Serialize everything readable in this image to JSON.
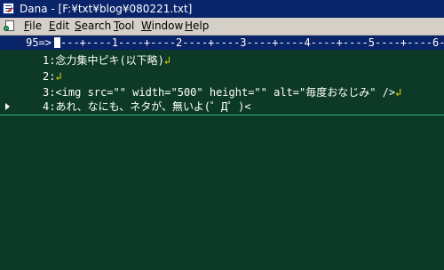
{
  "window": {
    "title": "Dana - [F:¥txt¥blog¥080221.txt]",
    "app_icon": "notepad-pen-icon"
  },
  "menubar": {
    "doc_icon": "document-icon",
    "items": [
      {
        "underline": "F",
        "rest": "ile"
      },
      {
        "underline": "E",
        "rest": "dit"
      },
      {
        "underline": "S",
        "rest": "earch"
      },
      {
        "underline": "T",
        "rest": "ool"
      },
      {
        "underline": "W",
        "rest": "indow"
      },
      {
        "underline": "H",
        "rest": "elp"
      }
    ]
  },
  "ruler": {
    "column_indicator": "95=>",
    "scale": "---+----1----+----2----+----3----+----4----+----5----+----6--"
  },
  "editor": {
    "lines": [
      {
        "number": "1:",
        "text": "念力集中ピキ(以下略)",
        "eol": "↲"
      },
      {
        "number": "2:",
        "text": "",
        "eol": "↲"
      },
      {
        "number": "3:",
        "text": "<img src=\"\" width=\"500\" height=\"\" alt=\"毎度おなじみ\" />",
        "eol": "↲"
      },
      {
        "number": "4:",
        "text": "あれ、なにも、ネタが、無いよ(゜Д゜)<",
        "eol": ""
      }
    ],
    "current_line": 4
  },
  "colors": {
    "titlebar": "#0a246a",
    "editor_background": "#0c3a26",
    "newline_mark": "#e8d800",
    "cursor_line": "#33b08a"
  }
}
